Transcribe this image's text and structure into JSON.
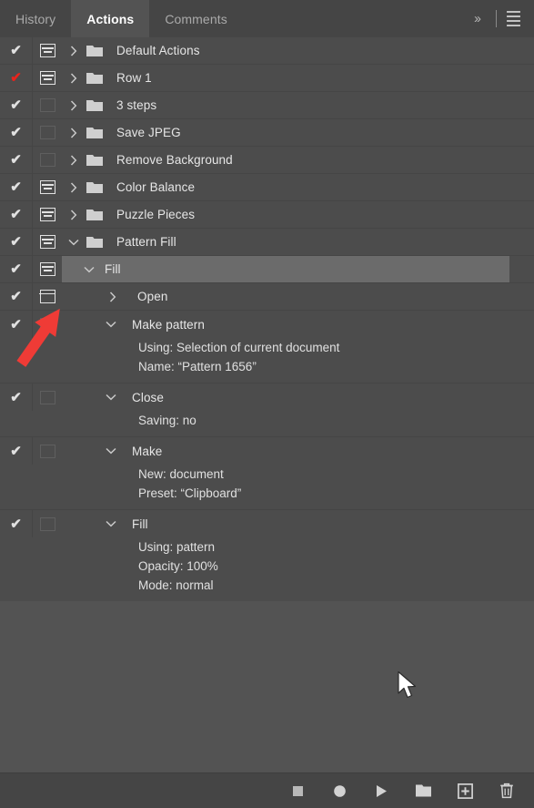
{
  "window": {
    "title": "Actions"
  },
  "tabs": [
    {
      "label": "History",
      "active": false
    },
    {
      "label": "Actions",
      "active": true
    },
    {
      "label": "Comments",
      "active": false
    }
  ],
  "tab_tools": {
    "more_label": "››",
    "more_icon": "double-chevron-right-icon",
    "menu_icon": "hamburger-menu-icon"
  },
  "action_sets": [
    {
      "label": "Default Actions",
      "checked": true,
      "check_color": "#e0e0e0",
      "dialog": "minus",
      "expanded": false
    },
    {
      "label": "Row 1",
      "checked": true,
      "check_color": "#e8231c",
      "dialog": "minus",
      "expanded": false
    },
    {
      "label": "3 steps",
      "checked": true,
      "check_color": "#e0e0e0",
      "dialog": "none",
      "expanded": false
    },
    {
      "label": "Save JPEG",
      "checked": true,
      "check_color": "#e0e0e0",
      "dialog": "none",
      "expanded": false
    },
    {
      "label": "Remove Background",
      "checked": true,
      "check_color": "#e0e0e0",
      "dialog": "none",
      "expanded": false
    },
    {
      "label": "Color Balance",
      "checked": true,
      "check_color": "#e0e0e0",
      "dialog": "minus",
      "expanded": false
    },
    {
      "label": "Puzzle Pieces",
      "checked": true,
      "check_color": "#e0e0e0",
      "dialog": "minus",
      "expanded": false
    },
    {
      "label": "Pattern Fill",
      "checked": true,
      "check_color": "#e0e0e0",
      "dialog": "minus",
      "expanded": true
    }
  ],
  "action": {
    "label": "Fill",
    "checked": true,
    "dialog": "minus",
    "expanded": true,
    "selected": true
  },
  "steps": [
    {
      "label": "Open",
      "checked": true,
      "dialog": "plain",
      "expanded": false,
      "details": []
    },
    {
      "label": "Make pattern",
      "checked": true,
      "dialog": "dim",
      "expanded": true,
      "details": [
        "Using: Selection of current document",
        "Name:  “Pattern 1656”"
      ]
    },
    {
      "label": "Close",
      "checked": true,
      "dialog": "dim",
      "expanded": true,
      "details": [
        "Saving: no"
      ]
    },
    {
      "label": "Make",
      "checked": true,
      "dialog": "dim",
      "expanded": true,
      "details": [
        "New: document",
        "Preset:  “Clipboard”"
      ]
    },
    {
      "label": "Fill",
      "checked": true,
      "dialog": "dim",
      "expanded": true,
      "details": [
        "Using: pattern",
        "Opacity: 100%",
        "Mode: normal"
      ]
    }
  ],
  "footer": {
    "buttons": [
      {
        "name": "stop-button",
        "icon": "stop-square-icon"
      },
      {
        "name": "record-button",
        "icon": "record-circle-icon"
      },
      {
        "name": "play-button",
        "icon": "play-triangle-icon"
      },
      {
        "name": "new-set-button",
        "icon": "new-folder-icon"
      },
      {
        "name": "new-action-button",
        "icon": "new-action-plus-icon"
      },
      {
        "name": "delete-button",
        "icon": "trash-icon"
      }
    ]
  },
  "annotations": {
    "pointer_arrow_color": "#ef3b36",
    "pointer_arrow_target": "open-step-dialog-toggle",
    "mouse_cursor": "arrow-cursor"
  },
  "colors": {
    "panel_bg": "#535353",
    "list_bg": "#4c4c4c",
    "tabbar_bg": "#454545",
    "selection": "#6b6b6b",
    "text": "#e6e6e6",
    "accent_red": "#e8231c"
  }
}
